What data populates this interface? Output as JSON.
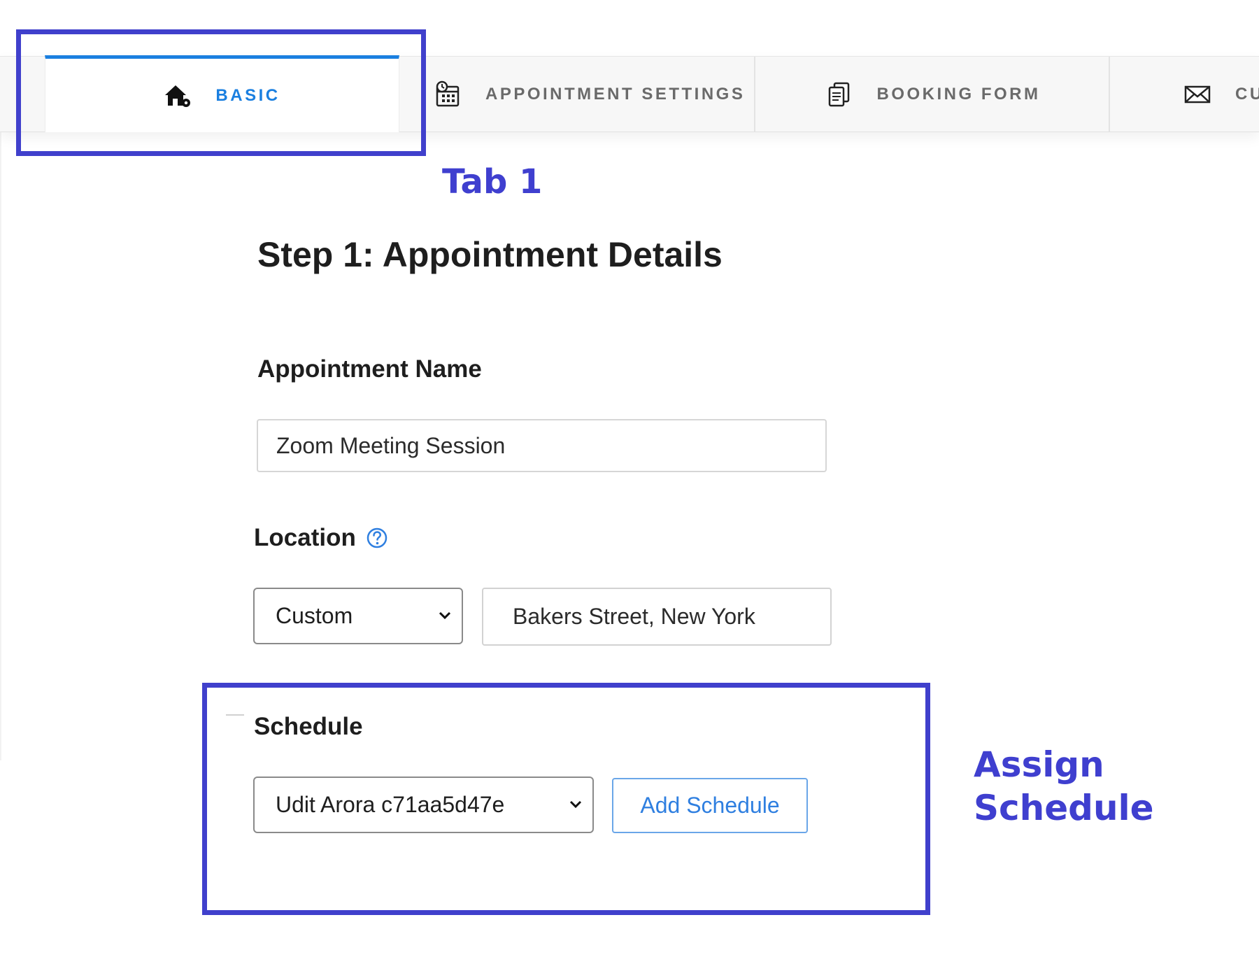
{
  "tabs": {
    "basic": {
      "label": "BASIC",
      "icon": "home-gear-icon",
      "active": true
    },
    "appointment_settings": {
      "label": "APPOINTMENT SETTINGS",
      "icon": "calendar-clock-icon"
    },
    "booking_form": {
      "label": "BOOKING FORM",
      "icon": "document-copy-icon"
    },
    "cu": {
      "label": "CU",
      "icon": "envelope-icon"
    }
  },
  "annotations": {
    "tab_label": "Tab 1",
    "schedule_label_line1": "Assign",
    "schedule_label_line2": "Schedule",
    "color": "#4040cc"
  },
  "form": {
    "step_title": "Step 1: Appointment Details",
    "appointment_name": {
      "label": "Appointment Name",
      "value": "Zoom Meeting Session"
    },
    "location": {
      "label": "Location",
      "type_selected": "Custom",
      "address_value": "Bakers Street, New York",
      "help_icon": "question-circle-icon"
    },
    "schedule": {
      "label": "Schedule",
      "selected": "Udit Arora c71aa5d47e",
      "add_button": "Add Schedule"
    }
  },
  "colors": {
    "accent": "#1a7fe0",
    "annotation": "#4040cc",
    "tab_text": "#6a6a6a"
  }
}
